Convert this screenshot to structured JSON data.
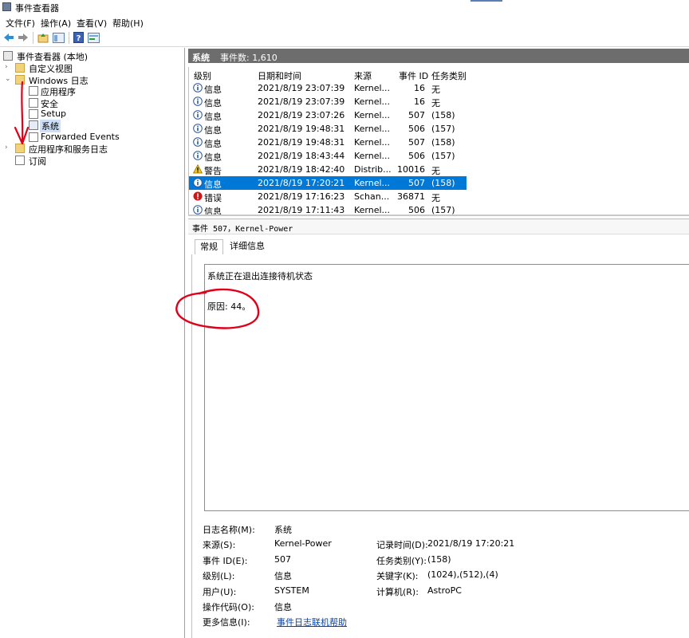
{
  "window": {
    "title": "事件查看器"
  },
  "menu": [
    "文件(F)",
    "操作(A)",
    "查看(V)",
    "帮助(H)"
  ],
  "toolbar": {
    "icons": [
      "back-arrow-icon",
      "forward-arrow-icon",
      "up-folder-icon",
      "console-tree-icon",
      "help-icon",
      "properties-icon"
    ]
  },
  "tree": {
    "root": "事件查看器 (本地)",
    "custom_views": "自定义视图",
    "windows_logs": "Windows 日志",
    "app_log": "应用程序",
    "security_log": "安全",
    "setup_log": "Setup",
    "system_log": "系统",
    "forwarded": "Forwarded Events",
    "app_services": "应用程序和服务日志",
    "subscriptions": "订阅"
  },
  "header": {
    "name": "系统",
    "count": "事件数: 1,610"
  },
  "columns": {
    "level": "级别",
    "datetime": "日期和时间",
    "source": "来源",
    "event_id": "事件 ID",
    "task": "任务类别"
  },
  "events": [
    {
      "level": "信息",
      "type": "info",
      "datetime": "2021/8/19 23:07:39",
      "source": "Kernel...",
      "event_id": "16",
      "task": "无"
    },
    {
      "level": "信息",
      "type": "info",
      "datetime": "2021/8/19 23:07:39",
      "source": "Kernel...",
      "event_id": "16",
      "task": "无"
    },
    {
      "level": "信息",
      "type": "info",
      "datetime": "2021/8/19 23:07:26",
      "source": "Kernel...",
      "event_id": "507",
      "task": "(158)"
    },
    {
      "level": "信息",
      "type": "info",
      "datetime": "2021/8/19 19:48:31",
      "source": "Kernel...",
      "event_id": "506",
      "task": "(157)"
    },
    {
      "level": "信息",
      "type": "info",
      "datetime": "2021/8/19 19:48:31",
      "source": "Kernel...",
      "event_id": "507",
      "task": "(158)"
    },
    {
      "level": "信息",
      "type": "info",
      "datetime": "2021/8/19 18:43:44",
      "source": "Kernel...",
      "event_id": "506",
      "task": "(157)"
    },
    {
      "level": "警告",
      "type": "warning",
      "datetime": "2021/8/19 18:42:40",
      "source": "Distrib...",
      "event_id": "10016",
      "task": "无"
    },
    {
      "level": "信息",
      "type": "info",
      "datetime": "2021/8/19 17:20:21",
      "source": "Kernel...",
      "event_id": "507",
      "task": "(158)",
      "selected": true
    },
    {
      "level": "错误",
      "type": "error",
      "datetime": "2021/8/19 17:16:23",
      "source": "Schan...",
      "event_id": "36871",
      "task": "无"
    },
    {
      "level": "信息",
      "type": "info",
      "datetime": "2021/8/19 17:11:43",
      "source": "Kernel...",
      "event_id": "506",
      "task": "(157)"
    }
  ],
  "detail": {
    "title": "事件 507，Kernel-Power",
    "tab_general": "常规",
    "tab_details": "详细信息",
    "message_line1": "系统正在退出连接待机状态",
    "message_line2": "原因: 44。"
  },
  "props": {
    "log_name_label": "日志名称(M):",
    "log_name": "系统",
    "source_label": "来源(S):",
    "source": "Kernel-Power",
    "recorded_label": "记录时间(D):",
    "recorded": "2021/8/19 17:20:21",
    "event_id_label": "事件 ID(E):",
    "event_id": "507",
    "task_label": "任务类别(Y):",
    "task": "(158)",
    "level_label": "级别(L):",
    "level": "信息",
    "keywords_label": "关键字(K):",
    "keywords": "(1024),(512),(4)",
    "user_label": "用户(U):",
    "user": "SYSTEM",
    "computer_label": "计算机(R):",
    "computer": "AstroPC",
    "opcode_label": "操作代码(O):",
    "opcode": "信息",
    "more_label": "更多信息(I):",
    "more_link": "事件日志联机帮助"
  },
  "colors": {
    "selection": "#0078d7",
    "header": "#6d6d6d",
    "annotation": "#e0001a",
    "link": "#0645ad"
  }
}
